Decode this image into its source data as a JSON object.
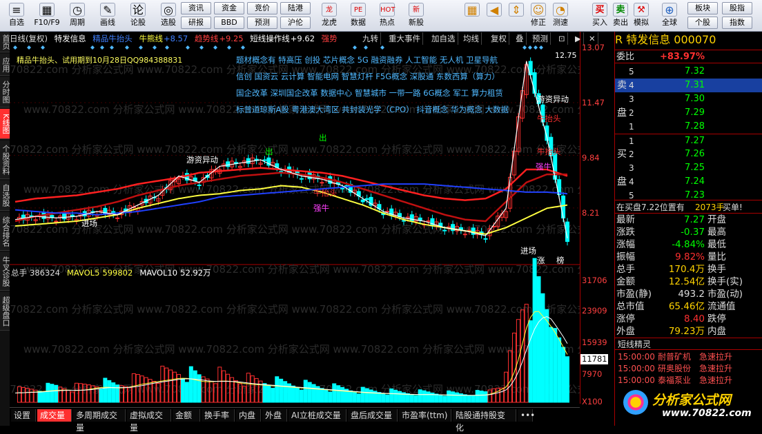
{
  "toolbar": {
    "buttons": [
      {
        "label": "自选",
        "icon": "self-select-icon",
        "glyph": "≡"
      },
      {
        "label": "F10/F9",
        "icon": "f10-icon",
        "glyph": "▦"
      },
      {
        "label": "周期",
        "icon": "period-icon",
        "glyph": "◷"
      },
      {
        "label": "画线",
        "icon": "draw-line-icon",
        "glyph": "✎"
      },
      {
        "label": "论股",
        "icon": "discuss-icon",
        "glyph": "论"
      },
      {
        "label": "选股",
        "icon": "stock-select-icon",
        "glyph": "◎"
      }
    ],
    "pills_top": [
      "资讯",
      "资金",
      "竞价",
      "陆港"
    ],
    "pills_bottom": [
      "研报",
      "BBD",
      "预测",
      "沪伦"
    ],
    "buttons2": [
      {
        "label": "龙虎",
        "icon": "dragon-tiger-icon",
        "glyph": "龙"
      },
      {
        "label": "数据",
        "icon": "data-icon",
        "glyph": "PE"
      },
      {
        "label": "热点",
        "icon": "hotspot-icon",
        "glyph": "HOT"
      },
      {
        "label": "新股",
        "icon": "new-stock-icon",
        "glyph": "新"
      }
    ],
    "buttons3": [
      {
        "label": "",
        "icon": "grid-icon",
        "glyph": "▦"
      },
      {
        "label": "",
        "icon": "back-arrow-icon",
        "glyph": "◀"
      },
      {
        "label": "",
        "icon": "up-down-icon",
        "glyph": "⇕"
      },
      {
        "label": "修正",
        "icon": "fix-icon",
        "glyph": "☺"
      },
      {
        "label": "测速",
        "icon": "speedtest-icon",
        "glyph": "◔"
      }
    ],
    "trade": [
      "买入",
      "卖出",
      "模拟"
    ],
    "trade_glyphs": [
      "买",
      "卖",
      "⚒"
    ],
    "global": {
      "label": "全球",
      "glyph": "⊕"
    },
    "right_pills_top": [
      "板块",
      "股指"
    ],
    "right_pills_bottom": [
      "个股",
      "指数"
    ]
  },
  "leftbar": [
    "首页",
    "应用",
    "分时图",
    "K线图",
    "个股资料",
    "自选股",
    "综合排名",
    "牛叉诊股",
    "超级盘口"
  ],
  "infobar": {
    "period": "日线(复权)",
    "stock": "特发信息",
    "indicator": "精品牛抬头",
    "bull_line_label": "牛熊线",
    "bull_line_val": "+8.57",
    "trend_label": "趋势线",
    "trend_val": "+9.25",
    "short_label": "短线操作线",
    "short_val": "+9.62",
    "strong": "强势"
  },
  "chart_buttons": [
    "九转",
    "重大事件",
    "加自选",
    "均线",
    "复权",
    "叠",
    "预测",
    "⊡",
    "▶",
    "✕"
  ],
  "chart_overlay": {
    "trial": "精品牛抬头、试用期到10月28日QQ984388831",
    "concepts": [
      "题材概念有 特高压 创投 芯片概念 5G 融资融券 人工智能 无人机 卫星导航",
      "信创 国资云 云计算 智能电网 智慧灯杆 F5G概念 深股通 东数西算（算力）",
      "国企改革 深圳国企改革 数据中心 智慧城市 一带一路 6G概念 军工 算力租赁",
      "标普道琼斯A股 粤港澳大湾区 共封装光学（CPO） 抖音概念 华为概念 大数据"
    ],
    "labels": [
      "游资异动",
      "进场",
      "出",
      "出",
      "牛抬头",
      "强牛",
      "进场",
      "游资异动",
      "牛抬头",
      "强牛",
      "牛抬头",
      "涨",
      "榜"
    ],
    "peak": "12.75"
  },
  "y_axis": [
    "13.07",
    "11.47",
    "9.84",
    "8.21"
  ],
  "vol_axis": [
    "31706",
    "23909",
    "15939",
    "7970",
    "X100"
  ],
  "vol_current": "11781",
  "vol_header": {
    "total_label": "总手",
    "total": "386324",
    "ma5_label": "MAVOL5",
    "ma5": "599802",
    "ma10_label": "MAVOL10",
    "ma10": "52.92万"
  },
  "bottom_tabs": [
    "设置",
    "成交量",
    "多周期成交量",
    "虚拟成交量",
    "金额",
    "换手率",
    "内盘",
    "外盘",
    "AI立桩成交量",
    "盘后成交量",
    "市盈率(ttm)",
    "陆股通持股变化",
    "•••"
  ],
  "chart_data": {
    "type": "line",
    "title": "特发信息",
    "xlabel": "",
    "ylabel": "",
    "ylim": [
      6.5,
      13.07
    ],
    "series": [
      {
        "name": "牛熊线",
        "values": [
          8.4,
          8.5,
          8.55,
          8.6,
          8.7,
          8.8,
          8.95,
          9.05,
          9.15,
          9.3,
          9.35,
          9.4,
          9.45,
          9.4,
          9.35,
          9.3,
          9.2,
          9.05,
          8.9,
          8.75,
          8.6,
          8.5,
          8.45,
          8.5,
          8.8,
          9.4,
          9.4,
          9.2
        ]
      },
      {
        "name": "趋势线",
        "values": [
          7.8,
          7.95,
          8.05,
          8.15,
          8.25,
          8.4,
          8.6,
          8.75,
          8.9,
          9.0,
          9.1,
          9.2,
          9.25,
          9.3,
          9.25,
          9.15,
          9.0,
          8.8,
          8.6,
          8.4,
          8.2,
          8.0,
          7.85,
          7.8,
          8.4,
          9.0,
          9.25,
          9.25
        ]
      },
      {
        "name": "短线操作线",
        "values": [
          7.65,
          7.7,
          7.75,
          7.8,
          7.9,
          8.0,
          8.2,
          8.35,
          8.5,
          8.6,
          8.65,
          8.75,
          8.8,
          8.9,
          8.85,
          8.7,
          8.5,
          8.3,
          8.05,
          7.85,
          7.7,
          7.6,
          7.5,
          7.4,
          7.6,
          7.9,
          8.2,
          8.3
        ]
      },
      {
        "name": "均线",
        "values": [
          8.15,
          8.1,
          8.05,
          8.05,
          8.0,
          8.05,
          8.1,
          8.2,
          8.3,
          8.4,
          8.55,
          8.6,
          8.65,
          8.7,
          8.75,
          8.8,
          8.85,
          8.9,
          8.95,
          8.95,
          8.95,
          8.9,
          8.85,
          8.8,
          8.75,
          8.7,
          8.7,
          8.65
        ]
      },
      {
        "name": "收盘",
        "values": [
          7.85,
          7.95,
          7.9,
          7.95,
          8.1,
          8.0,
          8.3,
          8.6,
          9.2,
          9.0,
          9.5,
          9.6,
          9.7,
          9.4,
          9.2,
          9.1,
          8.9,
          8.5,
          8.1,
          7.9,
          7.8,
          7.6,
          7.5,
          7.35,
          8.2,
          12.75,
          10.4,
          7.27
        ]
      }
    ],
    "volume": [
      3,
      3.5,
      4,
      3.8,
      5,
      4.5,
      6,
      7,
      8,
      6.5,
      7,
      6,
      5.5,
      5,
      4.5,
      4,
      3.5,
      3,
      2.8,
      2.5,
      2.5,
      2.3,
      2.2,
      2.5,
      6,
      31.7,
      24,
      11.8
    ]
  },
  "right": {
    "title": "R 特发信息 000070",
    "weibi_label": "委比",
    "weibi": "+83.97%",
    "sell": [
      [
        "5",
        "7.32"
      ],
      [
        "4",
        "7.31"
      ],
      [
        "3",
        "7.30"
      ],
      [
        "2",
        "7.29"
      ],
      [
        "1",
        "7.28"
      ]
    ],
    "buy": [
      [
        "1",
        "7.27"
      ],
      [
        "2",
        "7.26"
      ],
      [
        "3",
        "7.25"
      ],
      [
        "4",
        "7.24"
      ],
      [
        "5",
        "7.23"
      ]
    ],
    "sell_side": [
      "卖",
      "盘"
    ],
    "buy_side": [
      "买",
      "盘"
    ],
    "notice": "在买盘7.22位置有",
    "notice_num": "2073手",
    "notice_tail": "买单!",
    "stats": [
      [
        "最新",
        "7.27",
        "开盘",
        ""
      ],
      [
        "涨跌",
        "-0.37",
        "最高",
        ""
      ],
      [
        "涨幅",
        "-4.84%",
        "最低",
        ""
      ],
      [
        "振幅",
        "9.82%",
        "量比",
        ""
      ],
      [
        "总手",
        "170.4万",
        "换手",
        ""
      ],
      [
        "金额",
        "12.54亿",
        "换手(实)",
        ""
      ],
      [
        "市盈(静)",
        "493.2",
        "市盈(动)",
        ""
      ],
      [
        "总市值",
        "65.46亿",
        "流通值",
        ""
      ],
      [
        "涨停",
        "8.40",
        "跌停",
        ""
      ],
      [
        "外盘",
        "79.23万",
        "内盘",
        ""
      ]
    ],
    "news_title": "短线精灵",
    "news": [
      [
        "15:00:00",
        "耐普矿机",
        "急速拉升"
      ],
      [
        "15:00:00",
        "研奥股份",
        "急速拉升"
      ],
      [
        "15:00:00",
        "泰福泵业",
        "急速拉升"
      ]
    ],
    "logo": "分析家公式网",
    "logo_url_text": "www.70822.com"
  },
  "watermark": "www.70822.com 分析家公式网",
  "colors": {
    "up": "#ff3030",
    "down": "#00ffff",
    "yellow": "#ffd200",
    "green": "#00ff00",
    "red_line": "#ff2020",
    "blue_line": "#2040ff",
    "yellow_line": "#ffff40"
  }
}
